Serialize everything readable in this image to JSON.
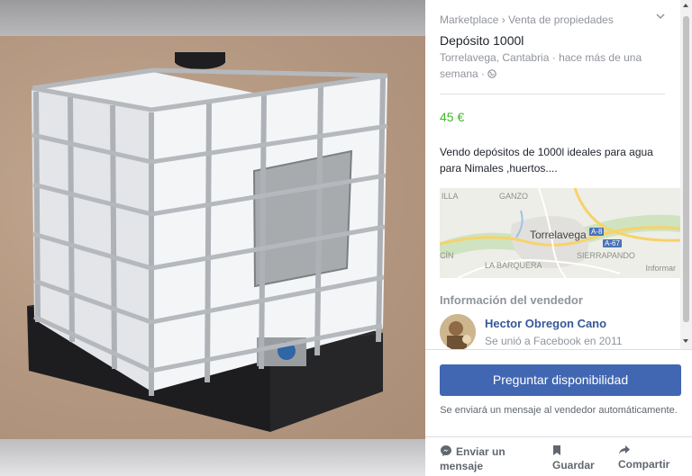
{
  "breadcrumb": {
    "root": "Marketplace",
    "separator": "›",
    "category": "Venta de propiedades"
  },
  "listing": {
    "title": "Depósito 1000l",
    "location": "Torrelavega, Cantabria · hace más de una semana ·",
    "price": "45 €",
    "description": "Vendo depósitos de 1000l ideales para agua para Nimales ,huertos...."
  },
  "map": {
    "city": "Torrelavega",
    "labels": {
      "ganzo": "GANZO",
      "barquera": "LA BARQUERA",
      "sierrapando": "SIERRAPANDO",
      "illa": "ILLA",
      "cin": "CÍN"
    },
    "roads": {
      "a8": "A-8",
      "a67": "A-67"
    },
    "report": "Informar"
  },
  "seller": {
    "heading": "Información del vendedor",
    "name": "Hector Obregon Cano",
    "joined": "Se unió a Facebook en 2011"
  },
  "cta": {
    "label": "Preguntar disponibilidad",
    "note": "Se enviará un mensaje al vendedor automáticamente."
  },
  "actions": [
    {
      "label": "Enviar un mensaje",
      "icon": "messenger-icon"
    },
    {
      "label": "Guardar",
      "icon": "bookmark-icon"
    },
    {
      "label": "Compartir",
      "icon": "share-icon"
    }
  ],
  "colors": {
    "accent": "#4267b2",
    "price": "#42b72a",
    "link": "#365899"
  }
}
